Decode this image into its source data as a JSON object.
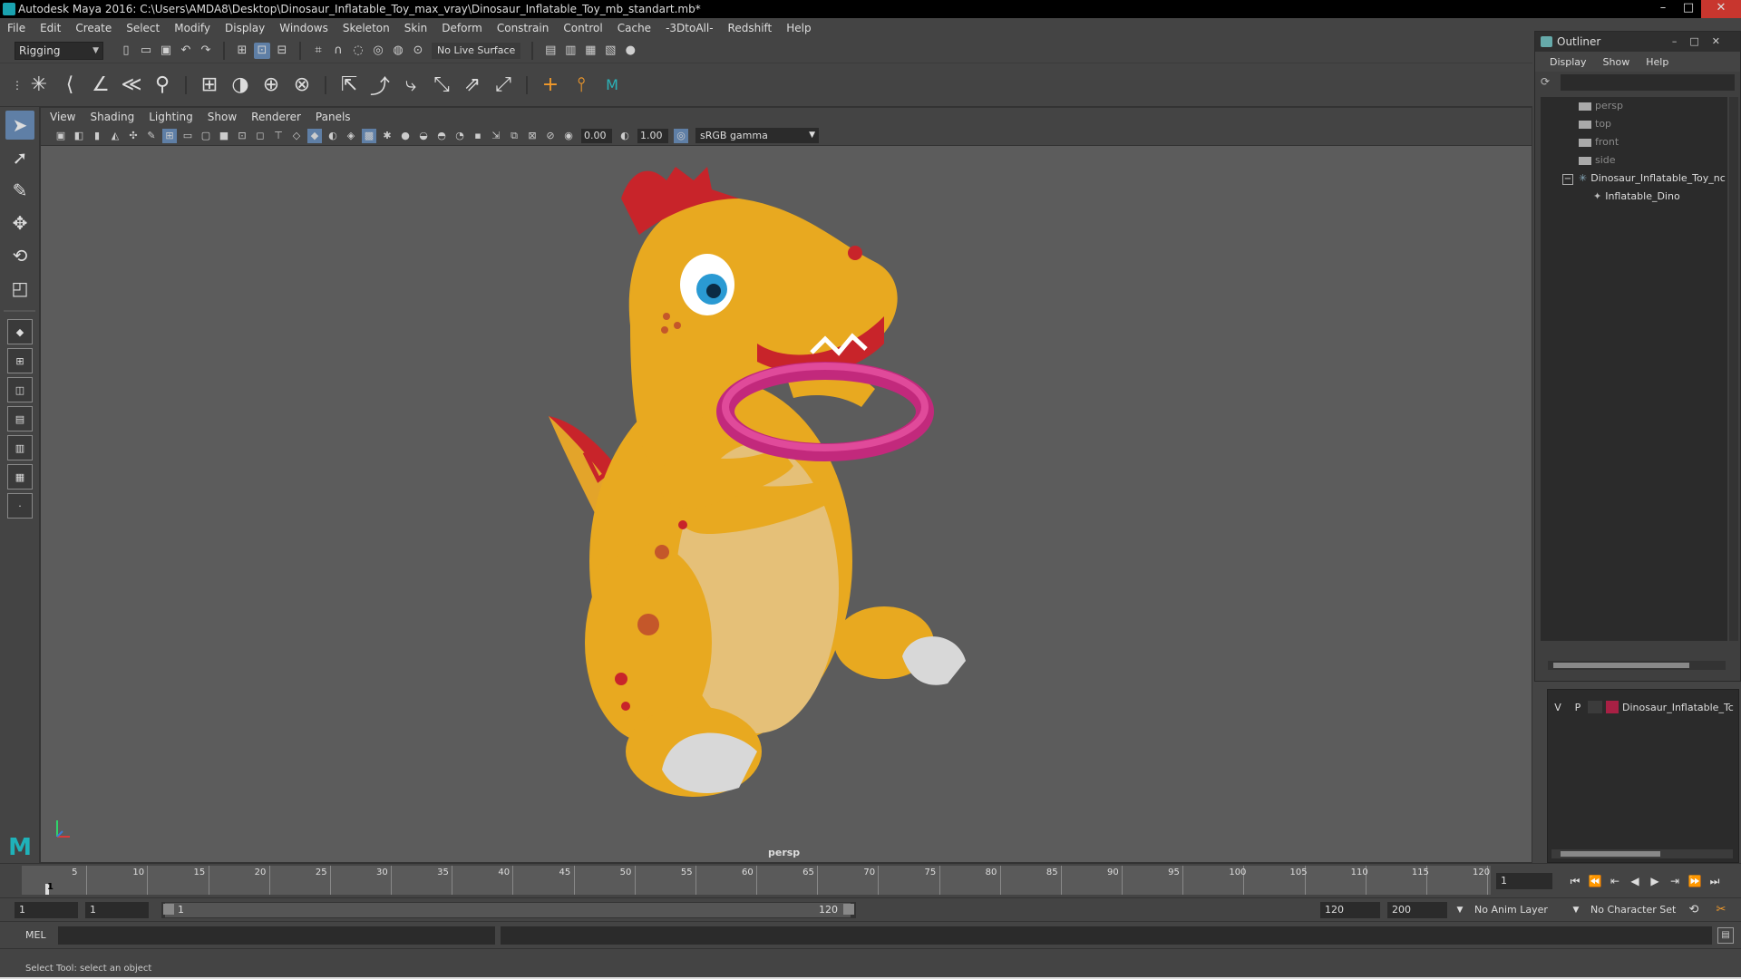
{
  "window": {
    "title": "Autodesk Maya 2016: C:\\Users\\AMDA8\\Desktop\\Dinosaur_Inflatable_Toy_max_vray\\Dinosaur_Inflatable_Toy_mb_standart.mb*",
    "minimize": "–",
    "maximize": "□",
    "close": "✕"
  },
  "menubar": [
    "File",
    "Edit",
    "Create",
    "Select",
    "Modify",
    "Display",
    "Windows",
    "Skeleton",
    "Skin",
    "Deform",
    "Constrain",
    "Control",
    "Cache",
    "-3DtoAll-",
    "Redshift",
    "Help"
  ],
  "status_line": {
    "mode": "Rigging",
    "live_surface": "No Live Surface"
  },
  "viewport": {
    "menus": [
      "View",
      "Shading",
      "Lighting",
      "Show",
      "Renderer",
      "Panels"
    ],
    "exposure": "0.00",
    "gamma": "1.00",
    "color_space": "sRGB gamma",
    "camera": "persp"
  },
  "outliner": {
    "title": "Outliner",
    "menus": [
      "Display",
      "Show",
      "Help"
    ],
    "items": [
      {
        "label": "persp",
        "indent": 0
      },
      {
        "label": "top",
        "indent": 0
      },
      {
        "label": "front",
        "indent": 0
      },
      {
        "label": "side",
        "indent": 0
      },
      {
        "label": "Dinosaur_Inflatable_Toy_nc",
        "indent": 0
      },
      {
        "label": "Inflatable_Dino",
        "indent": 1
      }
    ],
    "collapse_btn": "−"
  },
  "layer": {
    "v": "V",
    "p": "P",
    "name": "Dinosaur_Inflatable_Tc",
    "color": "#a82044"
  },
  "timeline": {
    "ticks": [
      "5",
      "10",
      "15",
      "20",
      "25",
      "30",
      "35",
      "40",
      "45",
      "50",
      "55",
      "60",
      "65",
      "70",
      "75",
      "80",
      "85",
      "90",
      "95",
      "100",
      "105",
      "110",
      "115",
      "120"
    ],
    "current_frame": "1",
    "current_field": "1"
  },
  "range": {
    "start": "1",
    "playback_start": "1",
    "slider_start": "1",
    "slider_end": "120",
    "playback_end": "120",
    "end": "200",
    "anim_layer": "No Anim Layer",
    "character_set": "No Character Set"
  },
  "command": {
    "label": "MEL"
  },
  "help_line": "Select Tool: select an object"
}
